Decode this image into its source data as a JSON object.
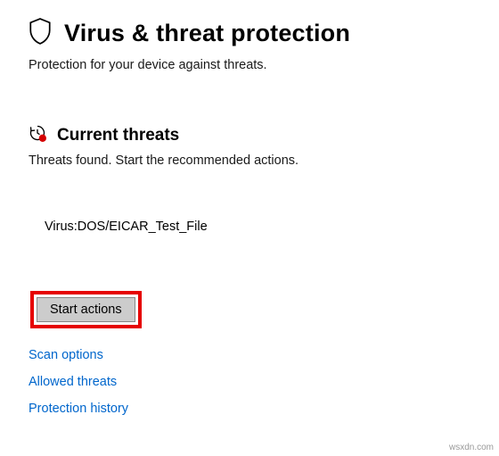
{
  "header": {
    "title": "Virus & threat protection",
    "subtitle": "Protection for your device against threats."
  },
  "currentThreats": {
    "title": "Current threats",
    "subtitle": "Threats found. Start the recommended actions.",
    "items": [
      "Virus:DOS/EICAR_Test_File"
    ]
  },
  "actions": {
    "startActions": "Start actions"
  },
  "links": {
    "scanOptions": "Scan options",
    "allowedThreats": "Allowed threats",
    "protectionHistory": "Protection history"
  },
  "watermark": "wsxdn.com"
}
